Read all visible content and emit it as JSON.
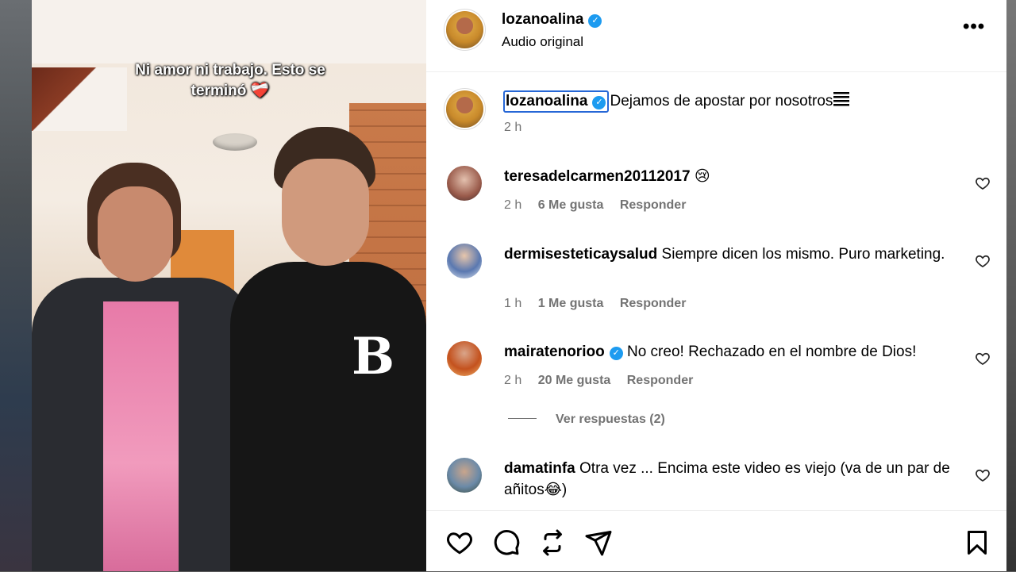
{
  "video": {
    "overlay_text": "Ni amor ni trabajo. Esto se terminó",
    "overlay_emoji": "❤️‍🩹",
    "shirt_logo": "B"
  },
  "header": {
    "username": "lozanoalina",
    "verified": true,
    "subtitle": "Audio original",
    "more_icon": "more-horizontal-icon"
  },
  "caption": {
    "username": "lozanoalina",
    "verified": true,
    "text": "Dejamos de apostar por nosotros",
    "time": "2 h"
  },
  "comments": [
    {
      "username": "teresadelcarmen20112017",
      "verified": false,
      "text": "😢",
      "time": "2 h",
      "likes": "6 Me gusta",
      "reply": "Responder",
      "avatar_color": "#c89a8a"
    },
    {
      "username": "dermisesteticaysalud",
      "verified": false,
      "text": "Siempre dicen los mismo. Puro marketing.",
      "time": "1 h",
      "likes": "1 Me gusta",
      "reply": "Responder",
      "avatar_color": "#3a5a9a"
    },
    {
      "username": "mairatenorioo",
      "verified": true,
      "text": "No creo! Rechazado en el nombre de Dios!",
      "time": "2 h",
      "likes": "20 Me gusta",
      "reply": "Responder",
      "avatar_color": "#d4622e"
    },
    {
      "username": "damatinfa",
      "verified": false,
      "text": "Otra vez ... Encima este video es viejo (va de un par de añitos😂)",
      "avatar_color": "#6b8aa8"
    }
  ],
  "view_replies": "Ver respuestas (2)",
  "actions": [
    "heart-icon",
    "comment-icon",
    "repost-icon",
    "share-icon",
    "bookmark-icon"
  ]
}
